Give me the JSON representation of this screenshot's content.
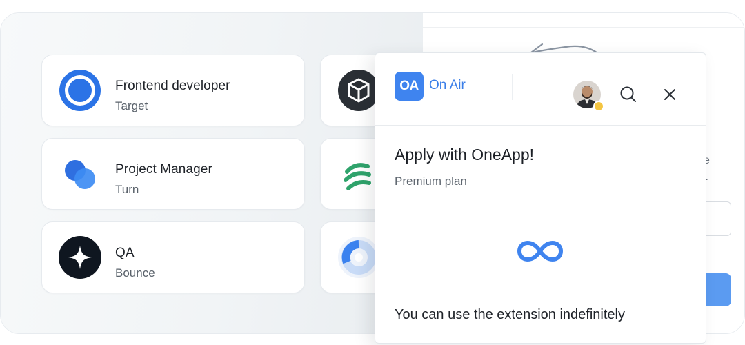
{
  "cards": [
    {
      "title": "Frontend developer",
      "subtitle": "Target",
      "logo": "target-logo"
    },
    {
      "title": "Project Manager",
      "subtitle": "Turn",
      "logo": "turn-logo"
    },
    {
      "title": "QA",
      "subtitle": "Bounce",
      "logo": "bounce-logo"
    }
  ],
  "partial_cards": [
    {
      "logo": "cube-logo"
    },
    {
      "logo": "stripes-logo"
    },
    {
      "logo": "donut-logo"
    }
  ],
  "background_fragments": {
    "text_1": "e",
    "text_2": "/."
  },
  "popup": {
    "logo_text": "OA",
    "brand": "On Air",
    "title": "Apply with OneApp!",
    "subtitle": "Premium plan",
    "description": "You can use the extension indefinitely",
    "icons": {
      "search": "search-icon",
      "close": "close-icon",
      "infinity": "infinity-icon"
    }
  },
  "colors": {
    "accent": "#3f84ef",
    "brand_text": "#3a7ee8",
    "green": "#2fa36b"
  }
}
